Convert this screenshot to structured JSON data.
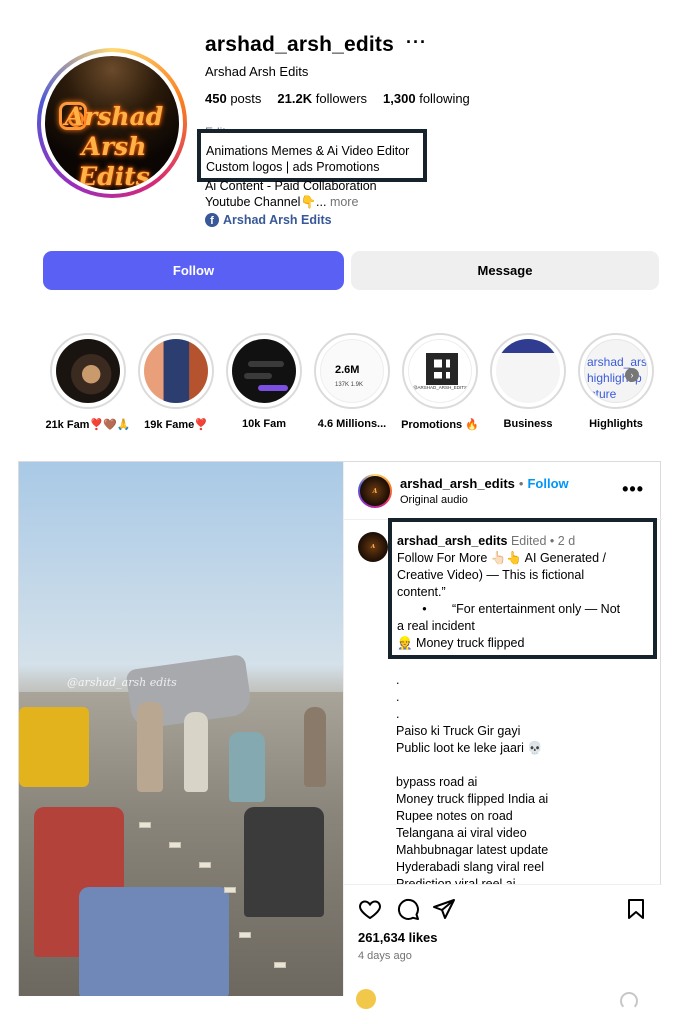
{
  "profile": {
    "username": "arshad_arsh_edits",
    "more_menu": "···",
    "display_name": "Arshad Arsh Edits",
    "avatar_text": "Arshad Arsh Edits",
    "stats": [
      {
        "count": "450",
        "label": "posts"
      },
      {
        "count": "21.2K",
        "label": "followers"
      },
      {
        "count": "1,300",
        "label": "following"
      }
    ],
    "category": "Editor",
    "bio_highlighted": [
      "Animations Memes & Ai Video Editor",
      "Custom logos | ads Promotions"
    ],
    "bio_rest": [
      "Ai Content - Paid Collaboration",
      "Youtube Channel👇..."
    ],
    "more_link": "more",
    "facebook_link": "Arshad Arsh Edits",
    "follow_button": "Follow",
    "message_button": "Message"
  },
  "highlights": [
    {
      "label": "21k Fam❣️🤎🙏"
    },
    {
      "label": "19k Fame❣️"
    },
    {
      "label": "10k Fam"
    },
    {
      "label": "4.6 Millions...",
      "inner_value": "2.6M",
      "inner_sub": "137K   1.9K"
    },
    {
      "label": "Promotions 🔥",
      "inner_caption": "@ARSHAD_ARSH_EDITS"
    },
    {
      "label": "Business"
    },
    {
      "label": "Highlights",
      "inner_text": "arshad_ars highlight p icture"
    }
  ],
  "post": {
    "watermark": "@arshad_arsh edits",
    "header": {
      "username": "arshad_arsh_edits",
      "separator": "•",
      "follow": "Follow",
      "audio": "Original audio",
      "more": "•••"
    },
    "caption": {
      "username": "arshad_arsh_edits",
      "edited": "Edited",
      "separator": "•",
      "age": "2 d",
      "line1": "Follow For More 👆🏻👆 AI Generated /",
      "line2": "Creative Video) — This is fictional",
      "line3": "content.”",
      "line4_bullet": "•",
      "line4": "“For entertainment only — Not",
      "line5": "a real incident",
      "line6": "👷 Money truck flipped"
    },
    "caption_rest": [
      ".",
      ".",
      ".",
      "Paiso ki Truck Gir gayi",
      "Public loot ke leke jaari 💀",
      "",
      "bypass road ai",
      "Money truck flipped India ai",
      "Rupee notes on road",
      "Telangana ai viral video",
      "Mahbubnagar latest update",
      "Hyderabadi slang viral reel",
      "Prediction viral reel ai"
    ],
    "likes": "261,634 likes",
    "posted": "4 days ago"
  },
  "colors": {
    "follow_button": "#5b60f5",
    "link_blue": "#0095f6",
    "facebook_blue": "#385898",
    "highlight_box_border": "#16232c"
  }
}
